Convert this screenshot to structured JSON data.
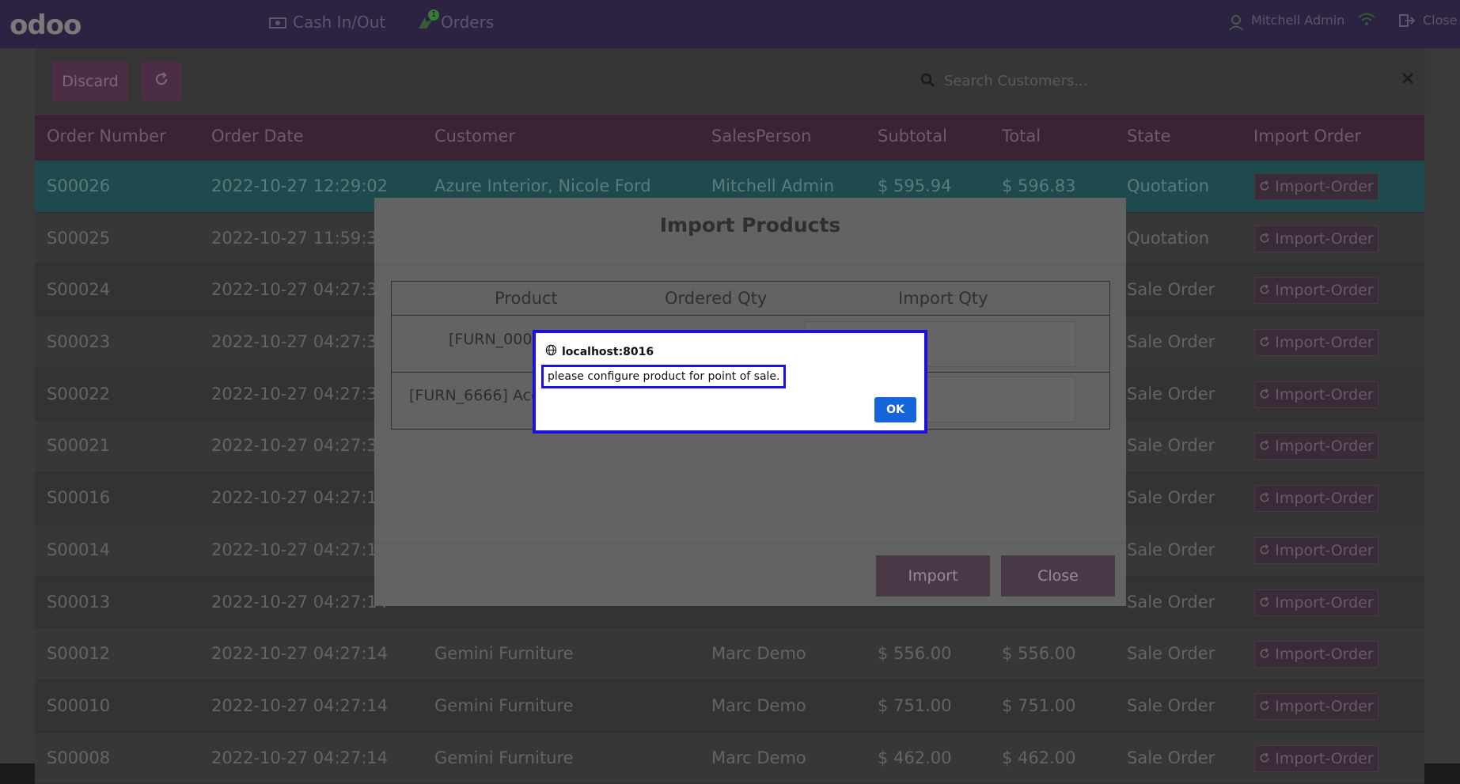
{
  "navbar": {
    "logo": "odoo",
    "cash_label": "Cash In/Out",
    "orders_label": "Orders",
    "orders_badge": "1",
    "user": "Mitchell Admin",
    "close_label": "Close"
  },
  "controls": {
    "discard": "Discard",
    "search_placeholder": "Search Customers..."
  },
  "table": {
    "headers": [
      "Order Number",
      "Order Date",
      "Customer",
      "SalesPerson",
      "Subtotal",
      "Total",
      "State",
      "Import Order"
    ],
    "import_label": "Import-Order",
    "rows": [
      {
        "num": "S00026",
        "date": "2022-10-27 12:29:02",
        "customer": "Azure Interior, Nicole Ford",
        "sales": "Mitchell Admin",
        "subtotal": "$ 595.94",
        "total": "$ 596.83",
        "state": "Quotation"
      },
      {
        "num": "S00025",
        "date": "2022-10-27 11:59:34",
        "customer": "",
        "sales": "",
        "subtotal": "",
        "total": "",
        "state": "Quotation"
      },
      {
        "num": "S00024",
        "date": "2022-10-27 04:27:36",
        "customer": "",
        "sales": "",
        "subtotal": "",
        "total": "",
        "state": "Sale Order"
      },
      {
        "num": "S00023",
        "date": "2022-10-27 04:27:36",
        "customer": "",
        "sales": "",
        "subtotal": "",
        "total": "",
        "state": "Sale Order"
      },
      {
        "num": "S00022",
        "date": "2022-10-27 04:27:36",
        "customer": "",
        "sales": "",
        "subtotal": "",
        "total": "",
        "state": "Sale Order"
      },
      {
        "num": "S00021",
        "date": "2022-10-27 04:27:36",
        "customer": "",
        "sales": "",
        "subtotal": "",
        "total": "",
        "state": "Sale Order"
      },
      {
        "num": "S00016",
        "date": "2022-10-27 04:27:14",
        "customer": "",
        "sales": "",
        "subtotal": "",
        "total": "",
        "state": "Sale Order"
      },
      {
        "num": "S00014",
        "date": "2022-10-27 04:27:14",
        "customer": "",
        "sales": "",
        "subtotal": "",
        "total": "",
        "state": "Sale Order"
      },
      {
        "num": "S00013",
        "date": "2022-10-27 04:27:14",
        "customer": "",
        "sales": "",
        "subtotal": "",
        "total": "",
        "state": "Sale Order"
      },
      {
        "num": "S00012",
        "date": "2022-10-27 04:27:14",
        "customer": "Gemini Furniture",
        "sales": "Marc Demo",
        "subtotal": "$ 556.00",
        "total": "$ 556.00",
        "state": "Sale Order"
      },
      {
        "num": "S00010",
        "date": "2022-10-27 04:27:14",
        "customer": "Gemini Furniture",
        "sales": "Marc Demo",
        "subtotal": "$ 751.00",
        "total": "$ 751.00",
        "state": "Sale Order"
      },
      {
        "num": "S00008",
        "date": "2022-10-27 04:27:14",
        "customer": "Gemini Furniture",
        "sales": "Marc Demo",
        "subtotal": "$ 462.00",
        "total": "$ 462.00",
        "state": "Sale Order"
      }
    ]
  },
  "modal": {
    "title": "Import Products",
    "col_product": "Product",
    "col_ordered": "Ordered Qty",
    "col_import": "Import Qty",
    "row1_product": "[FURN_0002",
    "row2_product": "[FURN_6666] Acou",
    "import_btn": "Import",
    "close_btn": "Close"
  },
  "alert": {
    "origin": "localhost:8016",
    "message": "please configure product for point of sale.",
    "ok": "OK"
  }
}
